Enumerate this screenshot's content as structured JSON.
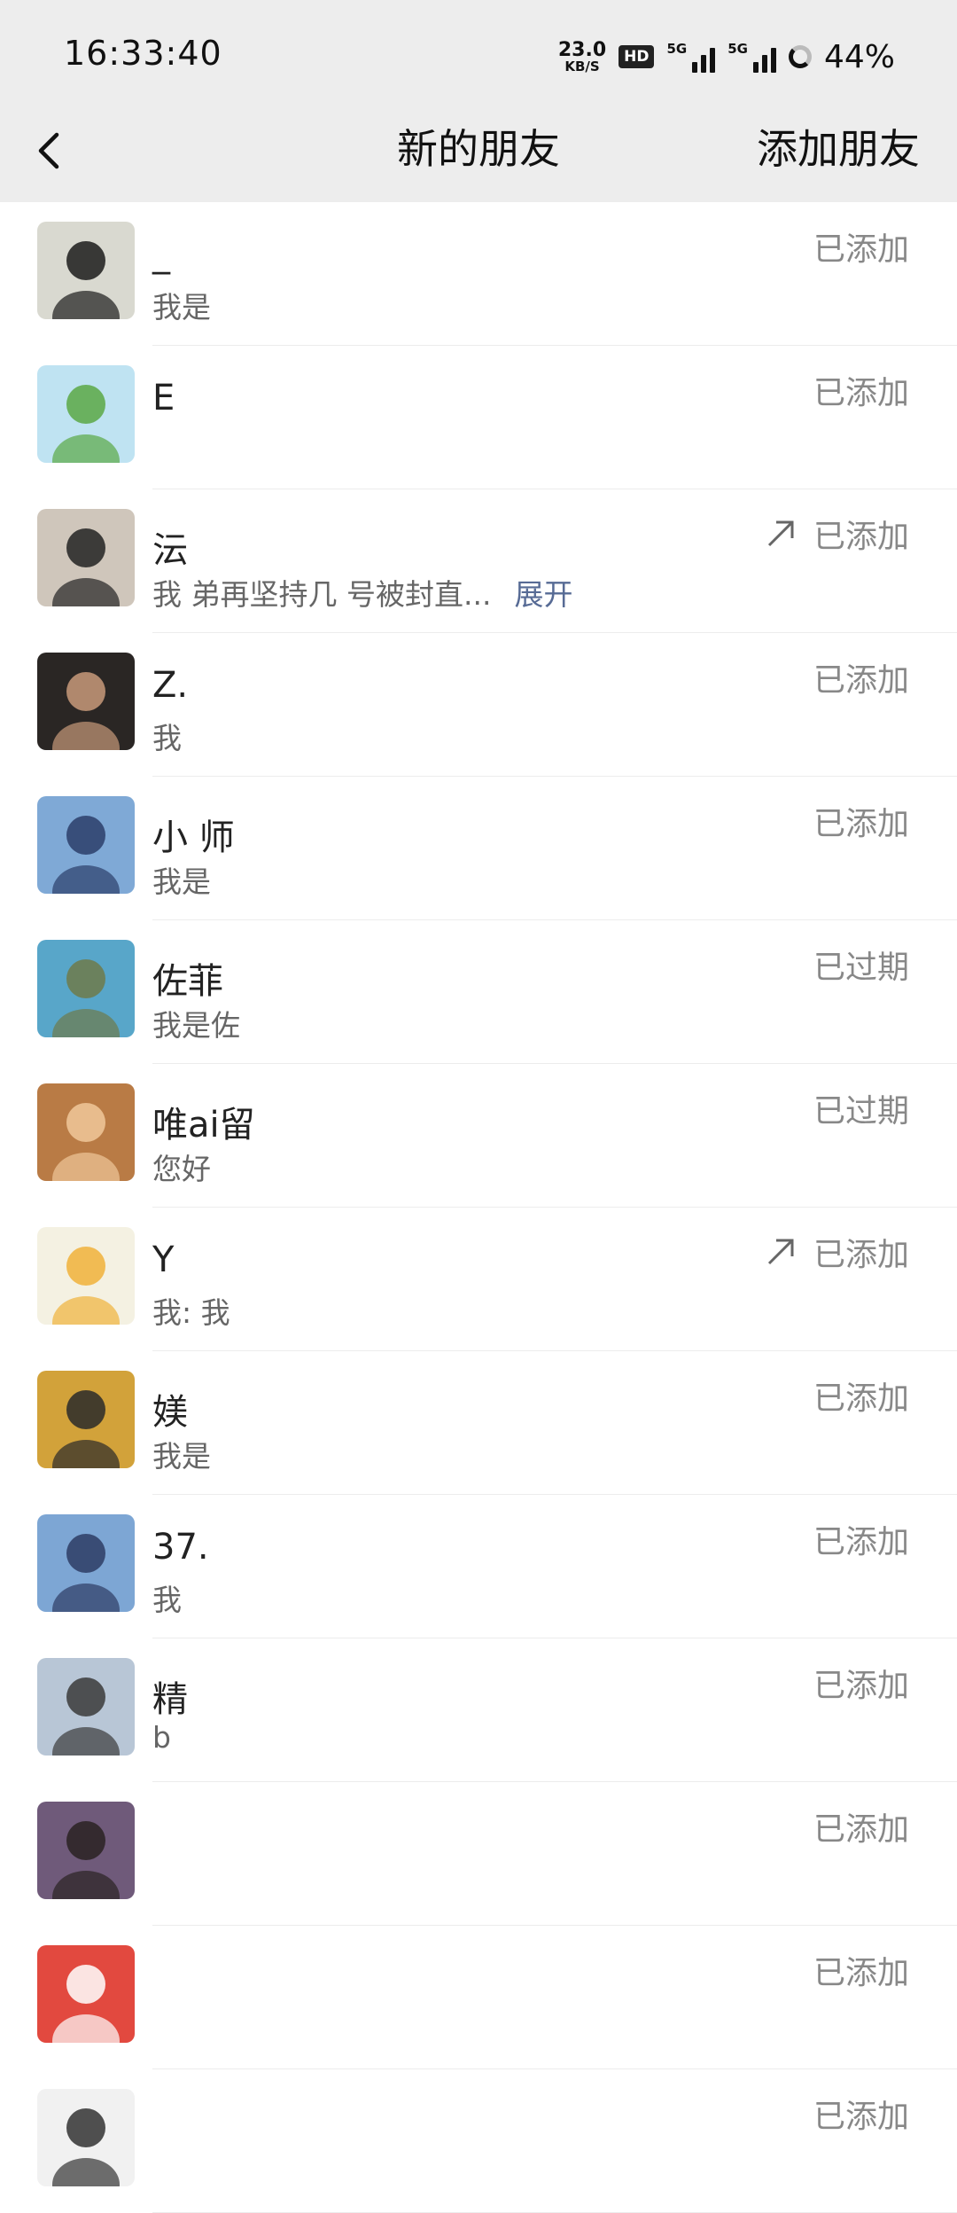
{
  "status_bar": {
    "time": "16:33:40",
    "net_speed_value": "23.0",
    "net_speed_unit": "KB/S",
    "hd_badge": "HD",
    "signal1_tag": "5G",
    "signal2_tag": "5G",
    "battery": "44%"
  },
  "nav": {
    "title": "新的朋友",
    "action": "添加朋友"
  },
  "colors": {
    "header_bg": "#ededed",
    "link": "#576b95",
    "status_text": "#888888"
  },
  "friends": [
    {
      "name": "_",
      "message": "我是",
      "status": "已添加",
      "shared": false,
      "avatar": {
        "bg": "#d9d9d0",
        "fg": "#1b1b1b"
      }
    },
    {
      "name": "E",
      "message": "",
      "status": "已添加",
      "shared": false,
      "avatar": {
        "bg": "#bfe3f2",
        "fg": "#5aa845"
      }
    },
    {
      "name": "沄",
      "message": "我  弟再坚持几  号被封直...",
      "expand": "展开",
      "status": "已添加",
      "shared": true,
      "avatar": {
        "bg": "#cfc6bb",
        "fg": "#222222"
      }
    },
    {
      "name": "Z.",
      "message": "我",
      "status": "已添加",
      "shared": false,
      "avatar": {
        "bg": "#2a2624",
        "fg": "#c89a7a"
      }
    },
    {
      "name": "小   师",
      "message": "我是",
      "status": "已添加",
      "shared": false,
      "avatar": {
        "bg": "#7fa9d6",
        "fg": "#2b3e6a"
      }
    },
    {
      "name": "佐菲",
      "message": "我是佐",
      "status": "已过期",
      "shared": false,
      "avatar": {
        "bg": "#58a6c9",
        "fg": "#6e7a4a"
      }
    },
    {
      "name": "唯ai留",
      "message": "您好",
      "status": "已过期",
      "shared": false,
      "avatar": {
        "bg": "#b97b45",
        "fg": "#f0c89a"
      }
    },
    {
      "name": "Y",
      "message": "我: 我",
      "status": "已添加",
      "shared": true,
      "avatar": {
        "bg": "#f4f1e2",
        "fg": "#f0b23a"
      }
    },
    {
      "name": "媄",
      "message": "我是",
      "status": "已添加",
      "shared": false,
      "avatar": {
        "bg": "#d2a23a",
        "fg": "#2a2a2a"
      }
    },
    {
      "name": "37.",
      "message": "我",
      "status": "已添加",
      "shared": false,
      "avatar": {
        "bg": "#7da6d4",
        "fg": "#2d3c64"
      }
    },
    {
      "name": "精",
      "message": "b",
      "status": "已添加",
      "shared": false,
      "avatar": {
        "bg": "#b8c6d6",
        "fg": "#3a3a3a"
      }
    },
    {
      "name": "",
      "message": "",
      "status": "已添加",
      "shared": false,
      "avatar": {
        "bg": "#6f5a7a",
        "fg": "#2a2222"
      }
    },
    {
      "name": "",
      "message": "",
      "status": "已添加",
      "shared": false,
      "avatar": {
        "bg": "#e2493f",
        "fg": "#ffffff"
      }
    },
    {
      "name": "",
      "message": "",
      "status": "已添加",
      "shared": false,
      "avatar": {
        "bg": "#f1f1f1",
        "fg": "#333333"
      }
    }
  ]
}
